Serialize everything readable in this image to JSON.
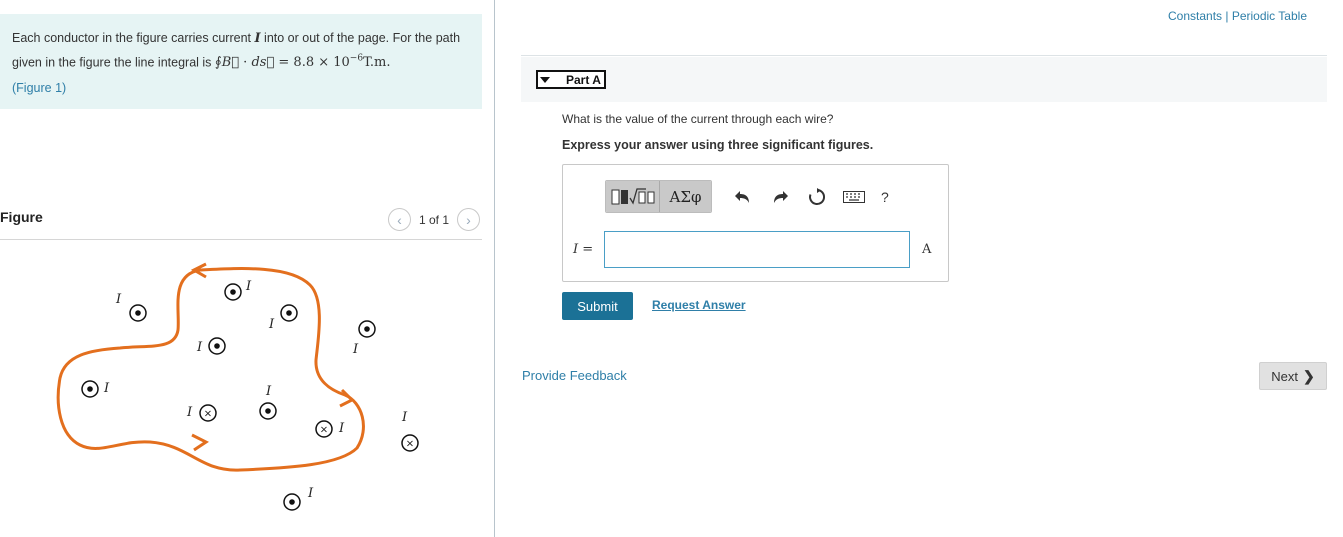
{
  "problem": {
    "text_part1": "Each conductor in the figure carries current ",
    "var_I": "I",
    "text_part2": " into or out of the page. For the path given in the figure the line integral is ",
    "integral_symbol": "∮",
    "B_vec": "B⃗",
    "dot": " · ",
    "ds_vec": "ds⃗",
    "equals": " = ",
    "value": "8.8 × 10",
    "exponent": "−6",
    "units": "T.m",
    "period": ".",
    "figure_link": "(Figure 1)"
  },
  "figure": {
    "title": "Figure",
    "pager_text": "1 of 1",
    "prev_glyph": "‹",
    "next_glyph": "›",
    "wire_label": "I",
    "out_symbol": "•",
    "in_symbol": "×",
    "colors": {
      "path": "#e36f1e",
      "wire": "#111111"
    }
  },
  "header_links": {
    "constants": "Constants",
    "separator": " | ",
    "periodic_table": "Periodic Table"
  },
  "part": {
    "label": "Part A",
    "question": "What is the value of the current through each wire?",
    "instructions": "Express your answer using three significant figures."
  },
  "toolbar": {
    "greek_label": "ΑΣφ",
    "help_label": "?"
  },
  "answer": {
    "variable": "I",
    "equals": " =",
    "value": "",
    "placeholder": "",
    "unit": "A"
  },
  "actions": {
    "submit": "Submit",
    "request_answer": "Request Answer",
    "provide_feedback": "Provide Feedback",
    "next": "Next",
    "next_chevron": "❯"
  },
  "colors": {
    "accent": "#1b7196",
    "link": "#2f7fa8",
    "problem_bg": "#e6f4f4",
    "input_border": "#4a9ec6"
  }
}
